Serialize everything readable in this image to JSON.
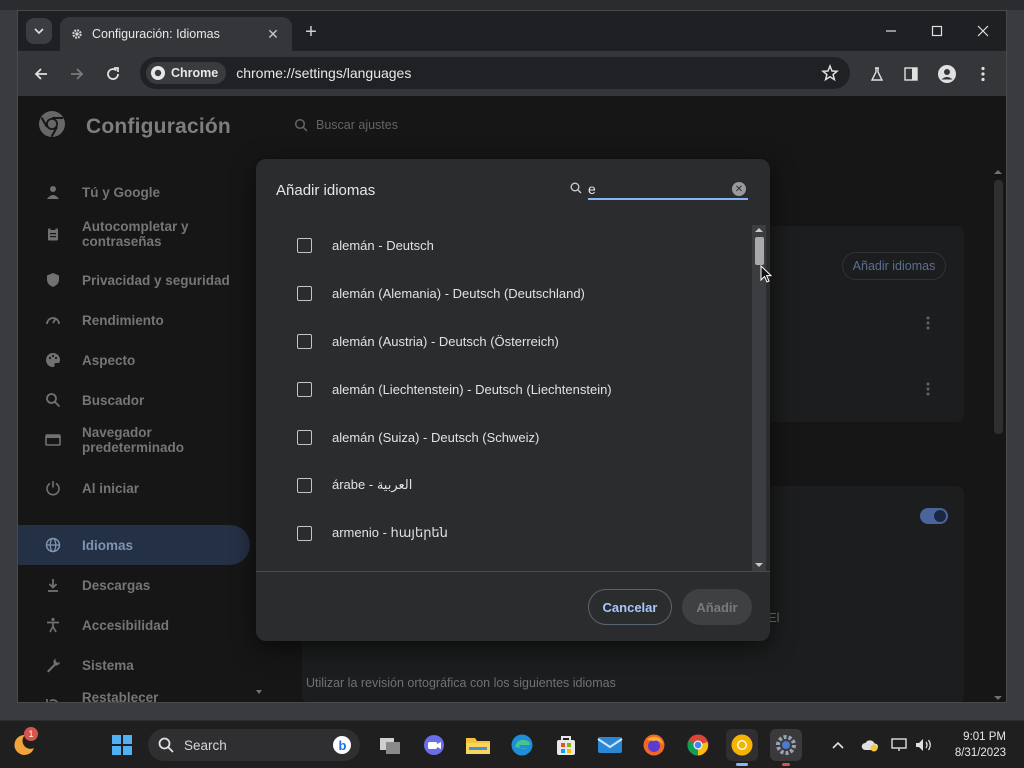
{
  "browser": {
    "tab_title": "Configuración: Idiomas",
    "chip_label": "Chrome",
    "url": "chrome://settings/languages"
  },
  "settings": {
    "app_title": "Configuración",
    "search_placeholder": "Buscar ajustes",
    "sidebar": [
      {
        "label": "Tú y Google",
        "icon": "person-icon"
      },
      {
        "label": "Autocompletar y contraseñas",
        "icon": "clipboard-icon"
      },
      {
        "label": "Privacidad y seguridad",
        "icon": "shield-icon"
      },
      {
        "label": "Rendimiento",
        "icon": "speedometer-icon"
      },
      {
        "label": "Aspecto",
        "icon": "palette-icon"
      },
      {
        "label": "Buscador",
        "icon": "search-icon"
      },
      {
        "label": "Navegador predeterminado",
        "icon": "browser-icon"
      },
      {
        "label": "Al iniciar",
        "icon": "power-icon"
      },
      {
        "label": "Idiomas",
        "icon": "globe-icon",
        "active": true
      },
      {
        "label": "Descargas",
        "icon": "download-icon"
      },
      {
        "label": "Accesibilidad",
        "icon": "accessibility-icon"
      },
      {
        "label": "Sistema",
        "icon": "wrench-icon"
      },
      {
        "label": "Restablecer configuración",
        "icon": "reset-icon"
      }
    ],
    "content": {
      "add_languages_button": "Añadir idiomas",
      "spellcheck_hint": "Utilizar la revisión ortográfica con los siguientes idiomas",
      "partial_text": "El"
    }
  },
  "dialog": {
    "title": "Añadir idiomas",
    "search_value": "e",
    "languages": [
      "alemán - Deutsch",
      "alemán (Alemania) - Deutsch (Deutschland)",
      "alemán (Austria) - Deutsch (Österreich)",
      "alemán (Liechtenstein) - Deutsch (Liechtenstein)",
      "alemán (Suiza) - Deutsch (Schweiz)",
      "árabe - العربية",
      "armenio - հայերեն"
    ],
    "cancel_label": "Cancelar",
    "add_label": "Añadir"
  },
  "taskbar": {
    "search_label": "Search",
    "notification_badge": "1",
    "time": "9:01 PM",
    "date": "8/31/2023"
  },
  "colors": {
    "accent": "#8ab4f8",
    "active_nav_bg": "#2c3b54",
    "toggle": "#5b7bbf"
  }
}
